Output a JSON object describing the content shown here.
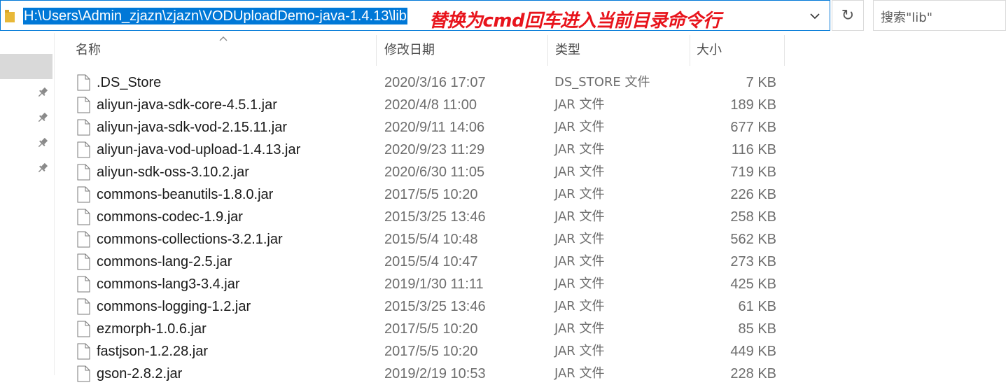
{
  "address_bar": {
    "path": "H:\\Users\\Admin_zjazn\\zjazn\\VODUploadDemo-java-1.4.13\\lib",
    "annotation": "替换为cmd回车进入当前目录命令行",
    "refresh_glyph": "↻",
    "dropdown_icon": "chevron-down-icon",
    "folder_icon": "folder-icon"
  },
  "search": {
    "placeholder": "搜索\"lib\""
  },
  "columns": {
    "name": "名称",
    "date": "修改日期",
    "type": "类型",
    "size": "大小"
  },
  "files": [
    {
      "name": ".DS_Store",
      "date": "2020/3/16 17:07",
      "type": "DS_STORE 文件",
      "size": "7 KB"
    },
    {
      "name": "aliyun-java-sdk-core-4.5.1.jar",
      "date": "2020/4/8 11:00",
      "type": "JAR 文件",
      "size": "189 KB"
    },
    {
      "name": "aliyun-java-sdk-vod-2.15.11.jar",
      "date": "2020/9/11 14:06",
      "type": "JAR 文件",
      "size": "677 KB"
    },
    {
      "name": "aliyun-java-vod-upload-1.4.13.jar",
      "date": "2020/9/23 11:29",
      "type": "JAR 文件",
      "size": "116 KB"
    },
    {
      "name": "aliyun-sdk-oss-3.10.2.jar",
      "date": "2020/6/30 11:05",
      "type": "JAR 文件",
      "size": "719 KB"
    },
    {
      "name": "commons-beanutils-1.8.0.jar",
      "date": "2017/5/5 10:20",
      "type": "JAR 文件",
      "size": "226 KB"
    },
    {
      "name": "commons-codec-1.9.jar",
      "date": "2015/3/25 13:46",
      "type": "JAR 文件",
      "size": "258 KB"
    },
    {
      "name": "commons-collections-3.2.1.jar",
      "date": "2015/5/4 10:48",
      "type": "JAR 文件",
      "size": "562 KB"
    },
    {
      "name": "commons-lang-2.5.jar",
      "date": "2015/5/4 10:47",
      "type": "JAR 文件",
      "size": "273 KB"
    },
    {
      "name": "commons-lang3-3.4.jar",
      "date": "2019/1/30 11:11",
      "type": "JAR 文件",
      "size": "425 KB"
    },
    {
      "name": "commons-logging-1.2.jar",
      "date": "2015/3/25 13:46",
      "type": "JAR 文件",
      "size": "61 KB"
    },
    {
      "name": "ezmorph-1.0.6.jar",
      "date": "2017/5/5 10:20",
      "type": "JAR 文件",
      "size": "85 KB"
    },
    {
      "name": "fastjson-1.2.28.jar",
      "date": "2017/5/5 10:20",
      "type": "JAR 文件",
      "size": "449 KB"
    },
    {
      "name": "gson-2.8.2.jar",
      "date": "2019/2/19 10:53",
      "type": "JAR 文件",
      "size": "228 KB"
    }
  ],
  "colors": {
    "selection": "#0078d7",
    "annotation": "#e8141c",
    "nav_selected": "#d9d9d9"
  }
}
